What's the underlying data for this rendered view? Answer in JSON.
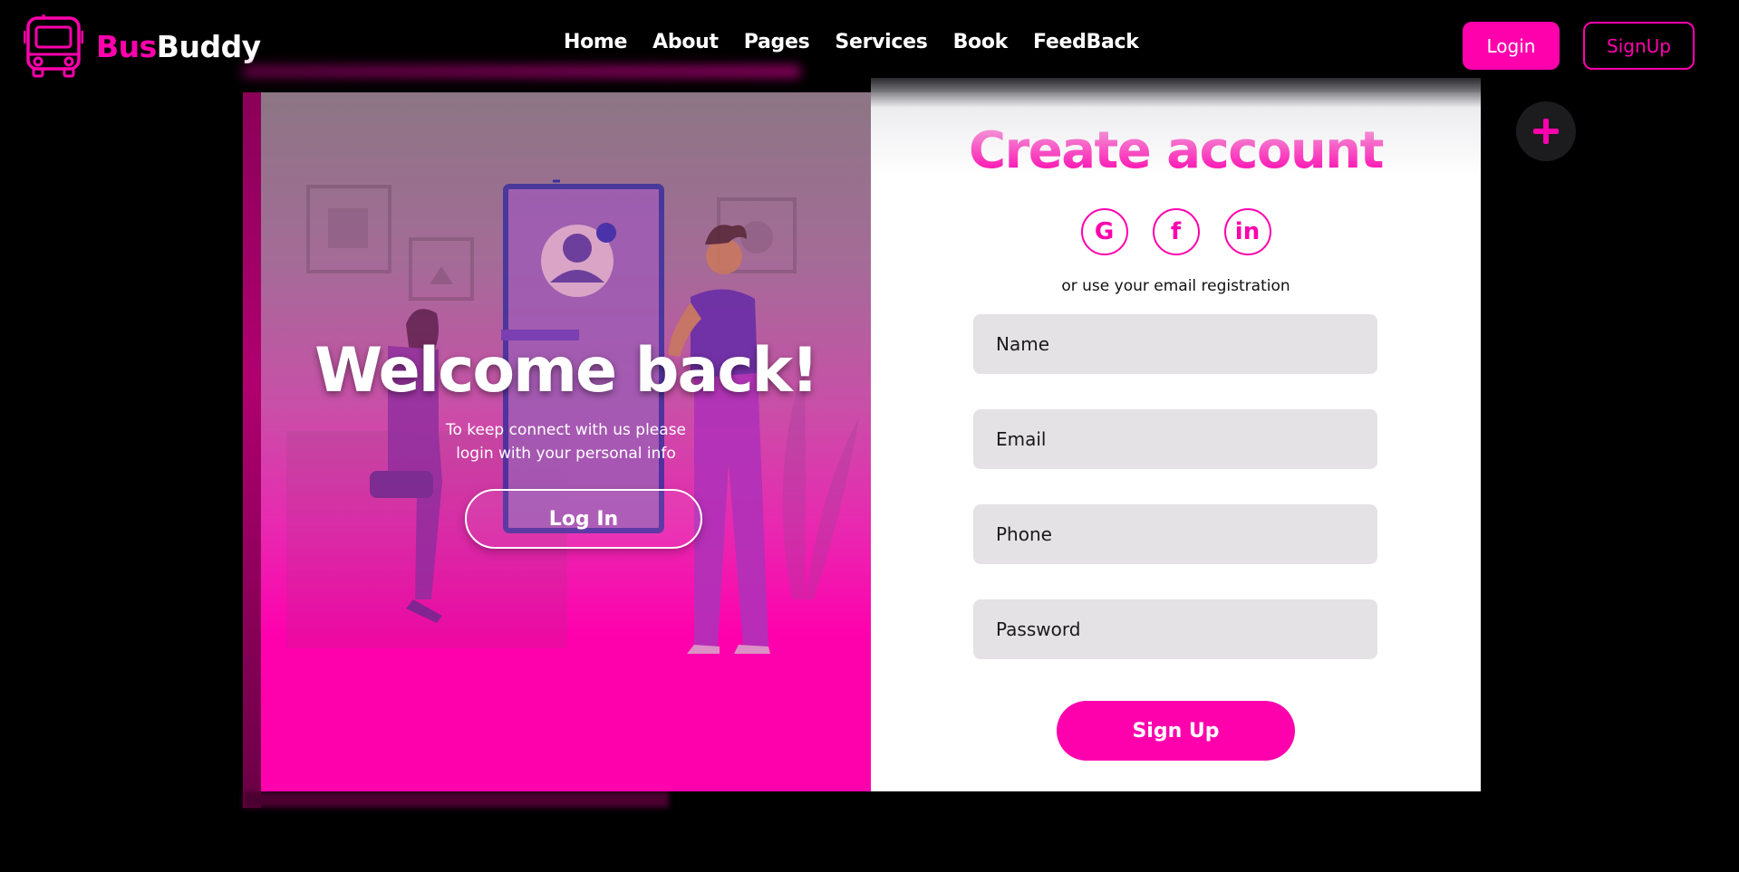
{
  "brand": {
    "name_part1": "Bus",
    "name_part2": "Buddy",
    "accent_color": "#ff00ad",
    "icon": "bus-icon"
  },
  "nav": {
    "links": [
      "Home",
      "About",
      "Pages",
      "Services",
      "Book",
      "FeedBack"
    ],
    "login_label": "Login",
    "signup_label": "SignUp"
  },
  "floating_action": {
    "icon": "plus-icon"
  },
  "left_panel": {
    "title": "Welcome back!",
    "subtitle": "To keep connect with us please login with your personal info",
    "button_label": "Log In"
  },
  "right_panel": {
    "title": "Create account",
    "social": [
      {
        "icon": "google-icon",
        "glyph": "G"
      },
      {
        "icon": "facebook-icon",
        "glyph": "f"
      },
      {
        "icon": "linkedin-icon",
        "glyph": "in"
      }
    ],
    "alt_text": "or use your email registration",
    "fields": {
      "name_placeholder": "Name",
      "email_placeholder": "Email",
      "phone_placeholder": "Phone",
      "password_placeholder": "Password"
    },
    "submit_label": "Sign Up"
  }
}
